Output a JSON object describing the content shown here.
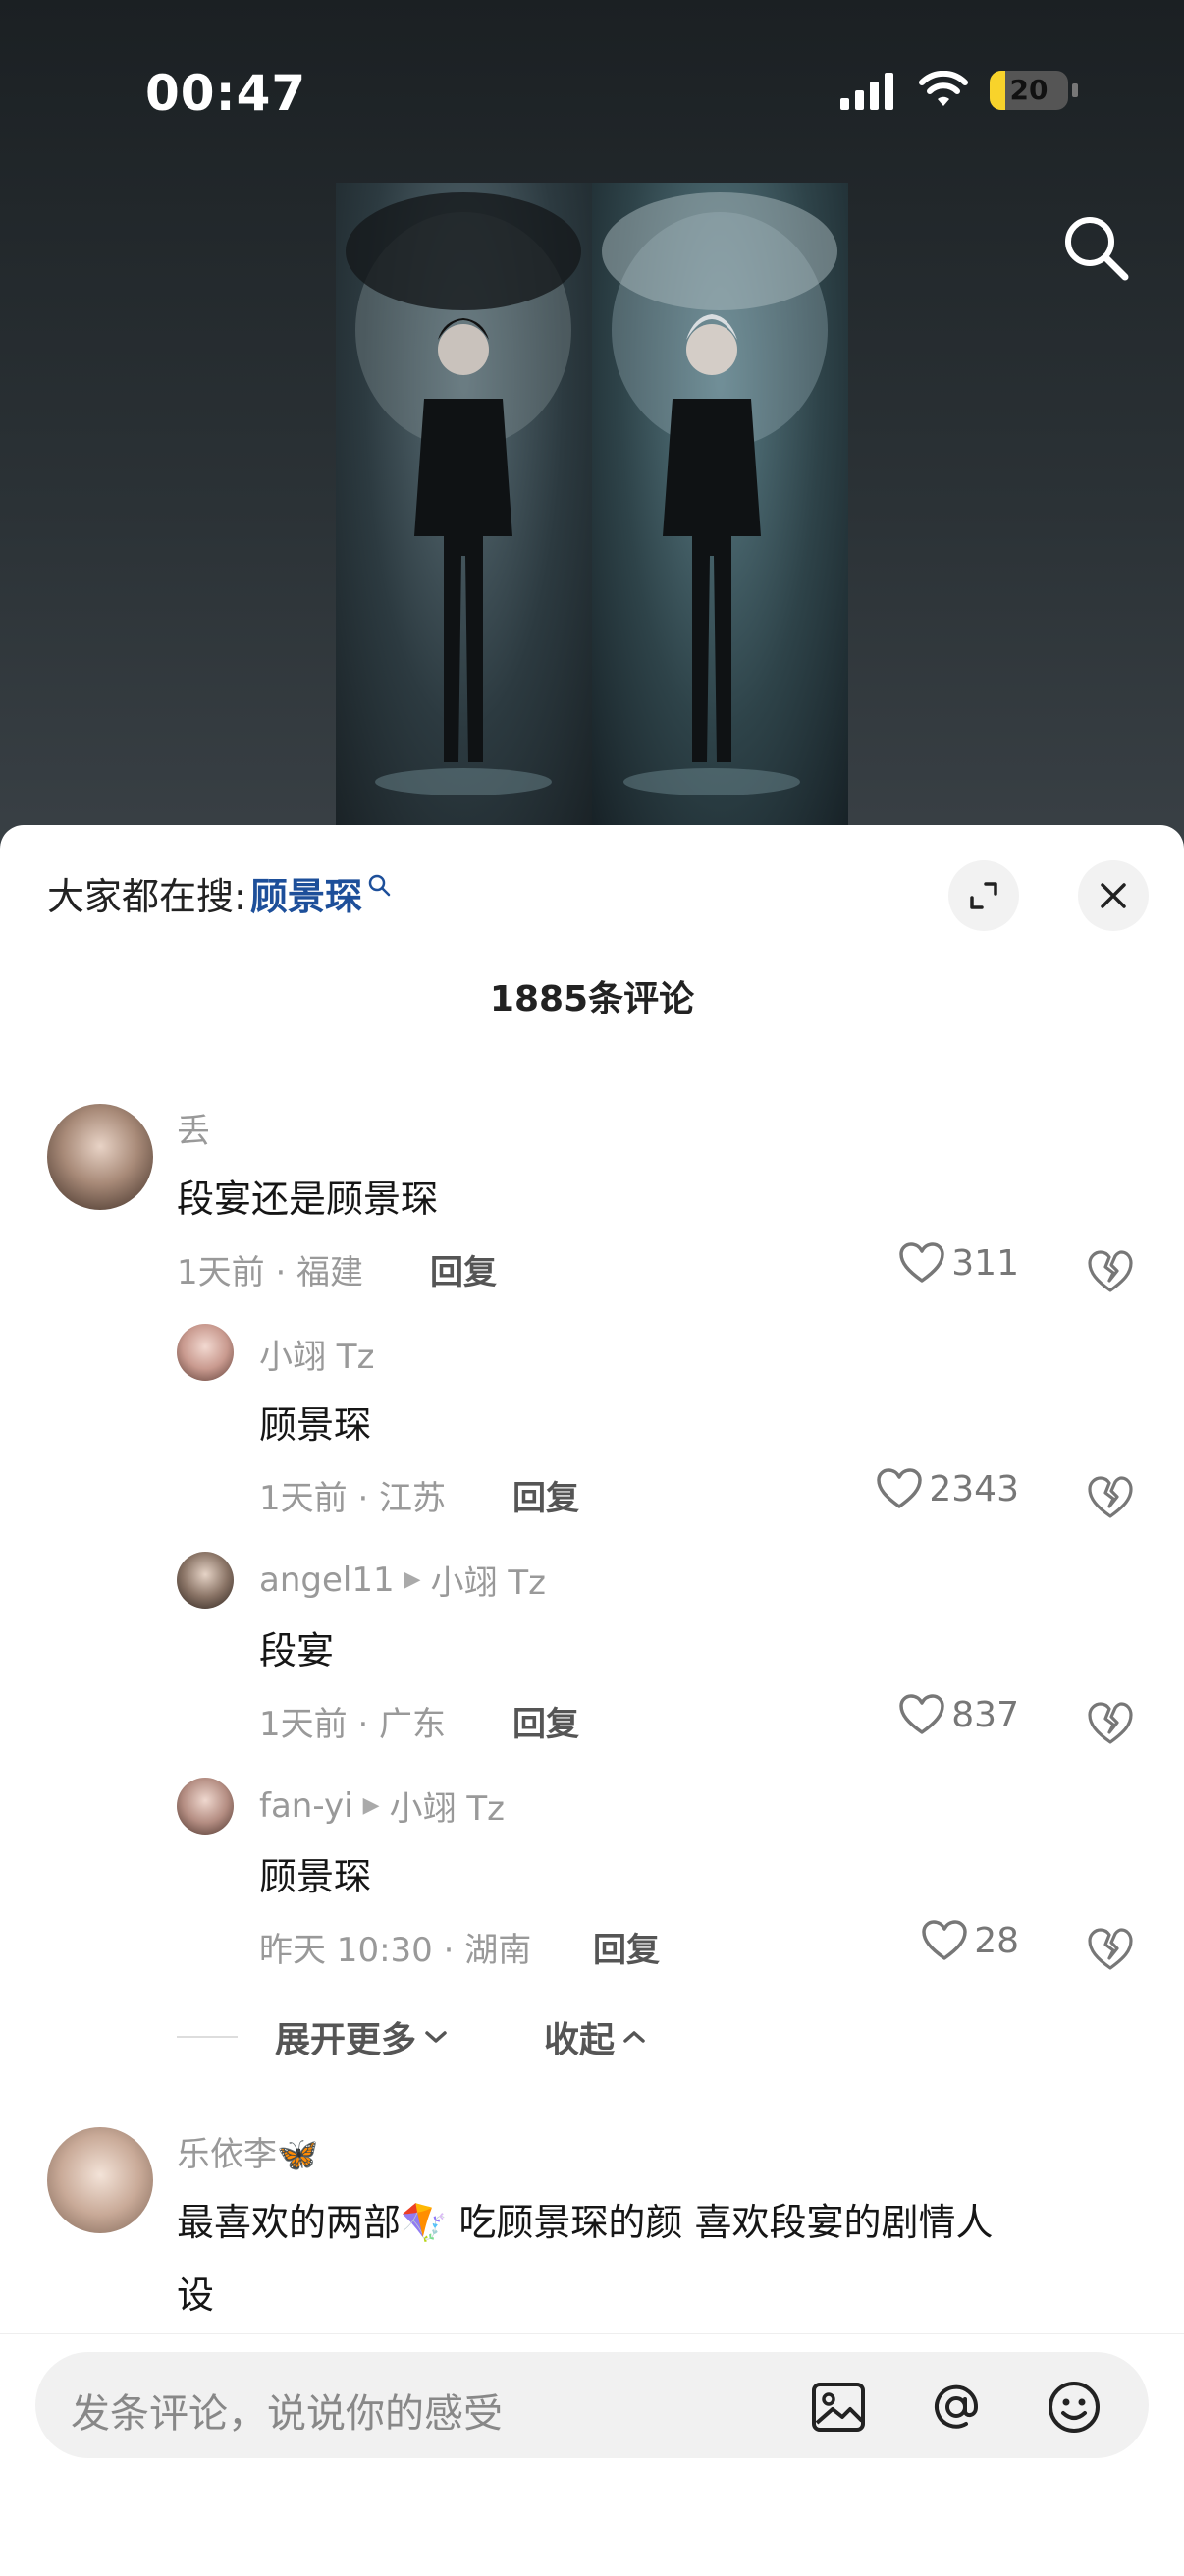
{
  "status": {
    "time": "00:47",
    "battery": "20",
    "battery_level": 0.2
  },
  "sheet": {
    "hot_search_prefix": "大家都在搜:",
    "hot_search_term": "顾景琛",
    "comment_count_label": "1885条评论"
  },
  "comments": [
    {
      "user": "丢",
      "text": "段宴还是顾景琛",
      "meta": "1天前 · 福建",
      "reply": "回复",
      "likes": "311",
      "replies": [
        {
          "user": "小翊 Tz",
          "reply_to": "",
          "text": "顾景琛",
          "meta": "1天前 · 江苏",
          "reply": "回复",
          "likes": "2343"
        },
        {
          "user": "angel11",
          "reply_to": "小翊 Tz",
          "text": "段宴",
          "meta": "1天前 · 广东",
          "reply": "回复",
          "likes": "837"
        },
        {
          "user": "fan-yi",
          "reply_to": "小翊 Tz",
          "text": "顾景琛",
          "meta": "昨天 10:30 · 湖南",
          "reply": "回复",
          "likes": "28"
        }
      ],
      "expand_more": "展开更多",
      "collapse": "收起"
    },
    {
      "user": "乐依李🦋",
      "text_line1": "最喜欢的两部🪁 吃顾景琛的颜 喜欢段宴的剧情人",
      "text_line2": "设"
    }
  ],
  "input": {
    "placeholder": "发条评论，说说你的感受"
  },
  "icons": {
    "search": "search-icon",
    "expand": "expand-icon",
    "close": "close-icon",
    "heart": "heart-icon",
    "dislike": "broken-heart-icon",
    "image": "image-icon",
    "mention": "at-icon",
    "emoji": "emoji-icon"
  },
  "colors": {
    "accent_blue": "#1d4f9a",
    "battery": "#f8d32b"
  }
}
